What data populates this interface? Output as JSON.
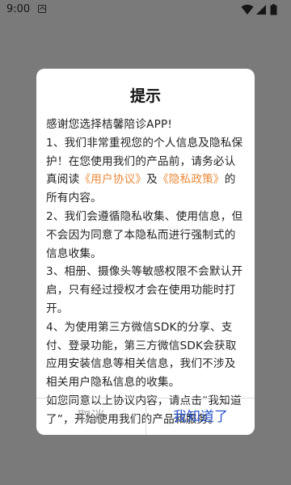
{
  "status_bar": {
    "time": "9:00",
    "icons": [
      "app-notification-icon",
      "wifi-icon",
      "signal-icon",
      "battery-icon"
    ]
  },
  "dialog": {
    "title": "提示",
    "greeting": "感谢您选择桔馨陪诊APP!",
    "p1_before": "1、我们非常重视您的个人信息及隐私保护！在您使用我们的产品前，请务必认真阅读",
    "user_agreement": "《用户协议》",
    "p1_and": "及",
    "privacy_policy": "《隐私政策》",
    "p1_after": "的所有内容。",
    "p2": "2、我们会遵循隐私收集、使用信息，但不会因为同意了本隐私而进行强制式的信息收集。",
    "p3": "3、相册、摄像头等敏感权限不会默认开启，只有经过授权才会在使用功能时打开。",
    "p4": "4、为使用第三方微信SDK的分享、支付、登录功能，第三方微信SDK会获取应用安装信息等相关信息，我们不涉及相关用户隐私信息的收集。",
    "p5": "如您同意以上协议内容，请点击“我知道了”，开始使用我们的产品和服务。",
    "cancel_label": "取消",
    "confirm_label": "我知道了"
  },
  "colors": {
    "overlay": "#7a7a7a",
    "link": "#e98a3a",
    "confirm": "#2a53c6",
    "cancel": "#a6a6a6"
  }
}
